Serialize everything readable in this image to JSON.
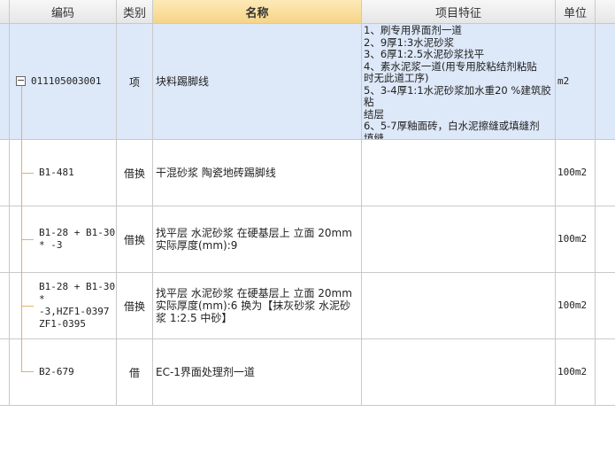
{
  "columns": {
    "code": "编码",
    "category": "类别",
    "name": "名称",
    "features": "项目特征",
    "unit": "单位"
  },
  "rows": [
    {
      "code": "011105003001",
      "category": "项",
      "name": "块料踢脚线",
      "features": [
        "1、刷专用界面剂一道",
        "2、9厚1:3水泥砂浆",
        "3、6厚1:2.5水泥砂浆找平",
        "4、素水泥浆一道(用专用胶粘结剂粘贴",
        "时无此道工序)",
        "5、3-4厚1:1水泥砂浆加水重20 %建筑胶粘",
        "结层",
        "6、5-7厚釉面砖，白水泥擦缝或填缝剂",
        "填缝"
      ],
      "unit": "m2",
      "expander": "−"
    },
    {
      "code_lines": [
        "B1-481"
      ],
      "category": "借换",
      "name_lines": [
        "干混砂浆 陶瓷地砖踢脚线"
      ],
      "unit": "100m2"
    },
    {
      "code_lines": [
        "B1-28 + B1-30",
        "* -3"
      ],
      "category": "借换",
      "name_lines": [
        "找平层 水泥砂浆 在硬基层上 立面 20mm",
        "实际厚度(mm):9"
      ],
      "unit": "100m2"
    },
    {
      "code_lines": [
        "B1-28 + B1-30",
        "*",
        "-3,HZF1-0397",
        "ZF1-0395"
      ],
      "category": "借换",
      "name_lines": [
        "找平层 水泥砂浆 在硬基层上 立面 20mm",
        "实际厚度(mm):6  换为【抹灰砂浆 水泥砂",
        "浆 1:2.5 中砂】"
      ],
      "unit": "100m2"
    },
    {
      "code_lines": [
        "B2-679"
      ],
      "category": "借",
      "name_lines": [
        "EC-1界面处理剂一道"
      ],
      "unit": "100m2"
    }
  ]
}
